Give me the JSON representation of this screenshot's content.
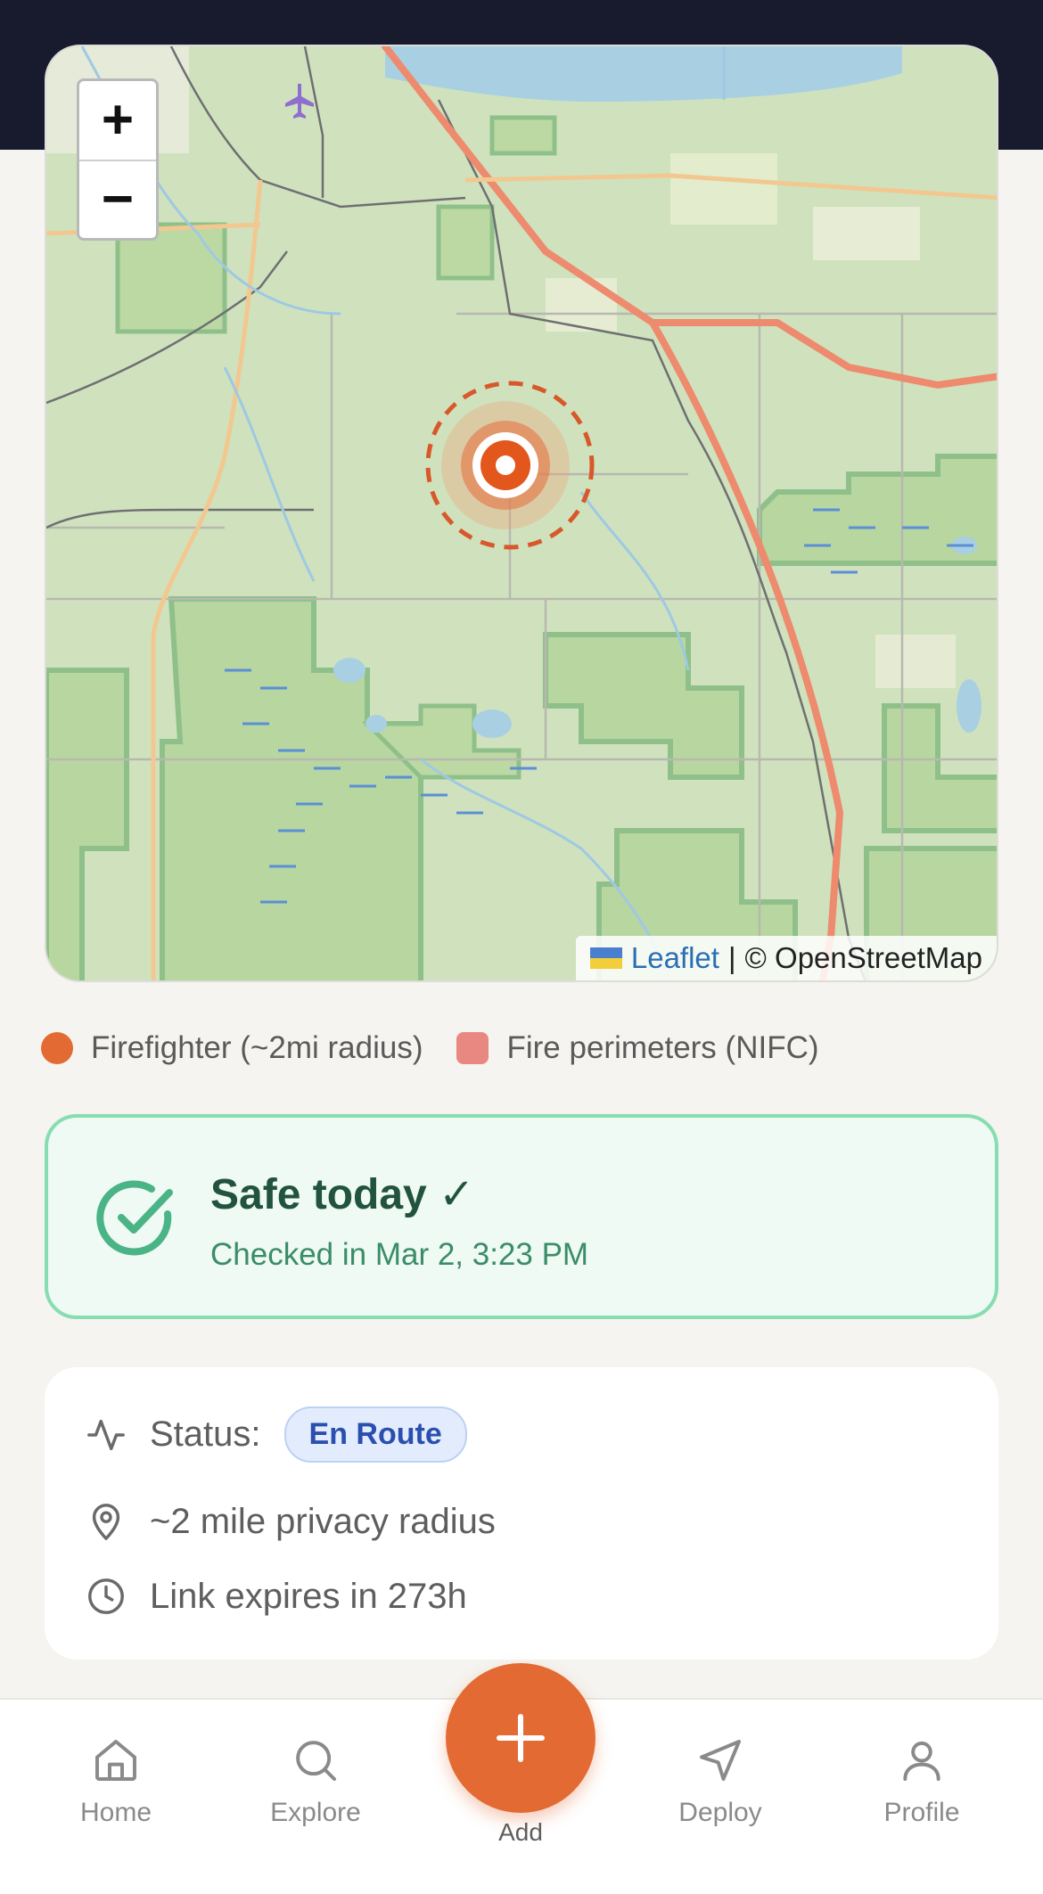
{
  "map": {
    "zoom_in_label": "+",
    "zoom_out_label": "−",
    "attribution_leaflet": "Leaflet",
    "attribution_separator": "|",
    "attribution_osm": "© OpenStreetMap"
  },
  "legend": {
    "firefighter": "Firefighter (~2mi radius)",
    "perimeters": "Fire perimeters (NIFC)"
  },
  "safe_card": {
    "title": "Safe today ✓",
    "subtitle": "Checked in Mar 2, 3:23 PM"
  },
  "info": {
    "status_label": "Status:",
    "status_value": "En Route",
    "radius_text": "~2 mile privacy radius",
    "expiry_text": "Link expires in 273h"
  },
  "nav": {
    "home": "Home",
    "explore": "Explore",
    "add": "Add",
    "deploy": "Deploy",
    "profile": "Profile"
  },
  "colors": {
    "accent": "#e36a33",
    "safe_border": "#86ddb1",
    "safe_title": "#22533f",
    "status_pill": "#2b4fae"
  },
  "icons": [
    "plus-icon",
    "minus-icon",
    "check-circle-icon",
    "activity-icon",
    "map-pin-icon",
    "clock-icon",
    "home-icon",
    "search-icon",
    "add-icon",
    "navigation-icon",
    "user-icon",
    "airport-icon"
  ]
}
